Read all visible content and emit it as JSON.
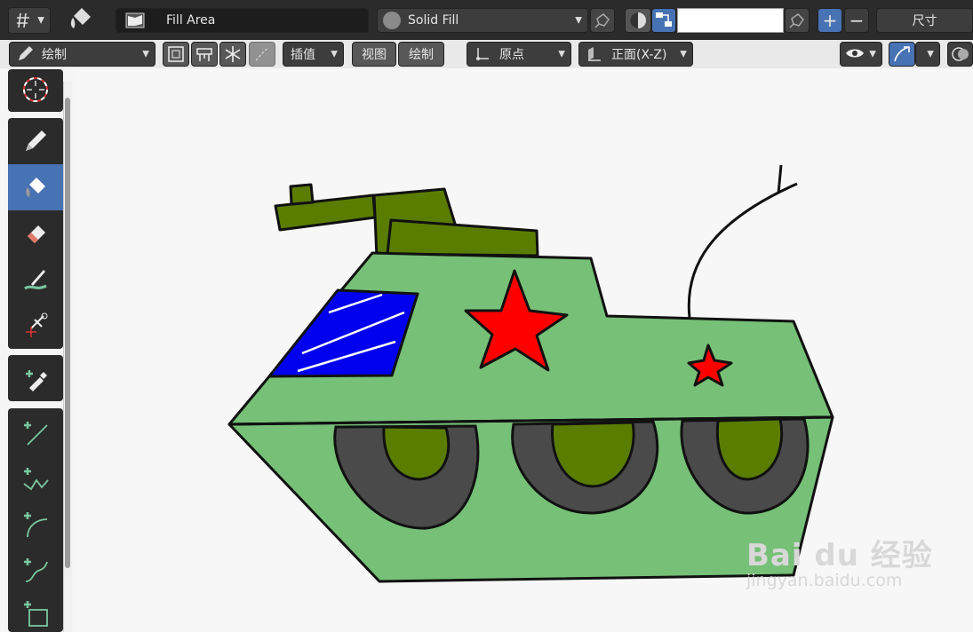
{
  "header": {
    "fill_area_label": "Fill Area",
    "fill_type_label": "Solid Fill",
    "size_label": "尺寸",
    "color_value": ""
  },
  "toolbar": {
    "draw_mode_label": "绘制",
    "interpolate_label": "插值",
    "view_label": "视图",
    "draw_label": "绘制",
    "origin_label": "原点",
    "orientation_label": "正面(X-Z)"
  },
  "tools": [
    {
      "name": "cursor-tool",
      "icon": "crosshair-cursor-icon"
    },
    {
      "name": "draw-tool",
      "icon": "pencil-icon"
    },
    {
      "name": "fill-tool",
      "icon": "paint-bucket-icon",
      "active": true
    },
    {
      "name": "erase-tool",
      "icon": "eraser-icon"
    },
    {
      "name": "tint-tool",
      "icon": "brush-tint-icon"
    },
    {
      "name": "cutter-tool",
      "icon": "scissors-cutter-icon"
    },
    {
      "name": "eyedropper-tool",
      "icon": "eyedropper-icon"
    },
    {
      "name": "line-tool",
      "icon": "line-icon"
    },
    {
      "name": "polyline-tool",
      "icon": "polyline-icon"
    },
    {
      "name": "arc-tool",
      "icon": "arc-icon"
    },
    {
      "name": "curve-tool",
      "icon": "curve-icon"
    },
    {
      "name": "box-tool",
      "icon": "box-icon"
    }
  ],
  "colors": {
    "accent": "#4772b3",
    "tank_light_green": "#76c077",
    "tank_dark_green": "#5a7d00",
    "wheel_gray": "#4a4a4a",
    "window_blue": "#0000ee",
    "star_red": "#ff0000"
  },
  "watermark": {
    "brand": "Bai du 经验",
    "url": "jingyan.baidu.com"
  }
}
